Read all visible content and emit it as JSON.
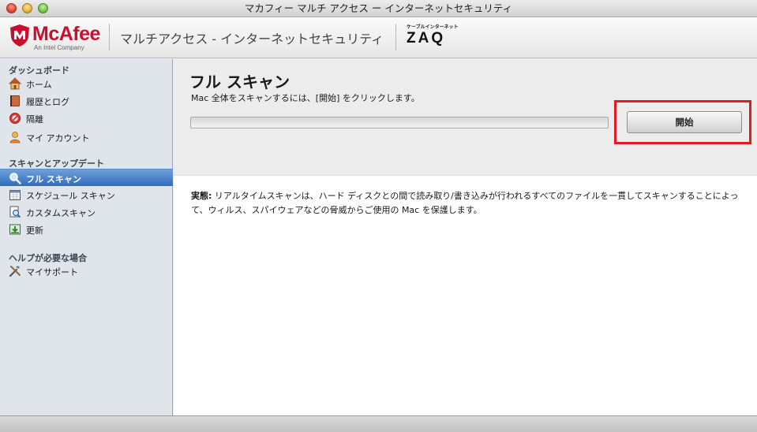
{
  "window": {
    "title": "マカフィー マルチ アクセス ー インターネットセキュリティ"
  },
  "header": {
    "brand": "McAfee",
    "brand_sub": "An Intel Company",
    "product_title": "マルチアクセス - インターネットセキュリティ",
    "partner_tagline": "ケーブルインターネット",
    "partner_logo": "ZAQ",
    "brand_color": "#c8102e"
  },
  "sidebar": {
    "sections": [
      {
        "title": "ダッシュボード",
        "items": [
          {
            "label": "ホーム",
            "icon": "home-icon"
          },
          {
            "label": "履歴とログ",
            "icon": "log-book-icon"
          },
          {
            "label": "隔離",
            "icon": "quarantine-icon"
          },
          {
            "label": "マイ アカウント",
            "icon": "account-icon"
          }
        ]
      },
      {
        "title": "スキャンとアップデート",
        "items": [
          {
            "label": "フル スキャン",
            "icon": "magnifier-icon",
            "selected": true
          },
          {
            "label": "スケジュール スキャン",
            "icon": "calendar-icon"
          },
          {
            "label": "カスタムスキャン",
            "icon": "custom-scan-icon"
          },
          {
            "label": "更新",
            "icon": "update-icon"
          }
        ]
      },
      {
        "title": "ヘルプが必要な場合",
        "items": [
          {
            "label": "マイサポート",
            "icon": "tools-icon"
          }
        ]
      }
    ],
    "selected_color": "#2f6cbf"
  },
  "main": {
    "title": "フル スキャン",
    "subtitle": "Mac 全体をスキャンするには、[開始] をクリックします。",
    "progress": 0,
    "start_button": "開始",
    "highlight_color": "#e01b24",
    "desc_label": "実態:",
    "desc_text": " リアルタイムスキャンは、ハード ディスクとの間で読み取り/書き込みが行われるすべてのファイルを一貫してスキャンすることによって、ウィルス、スパイウェアなどの脅威からご使用の Mac を保護します。"
  }
}
